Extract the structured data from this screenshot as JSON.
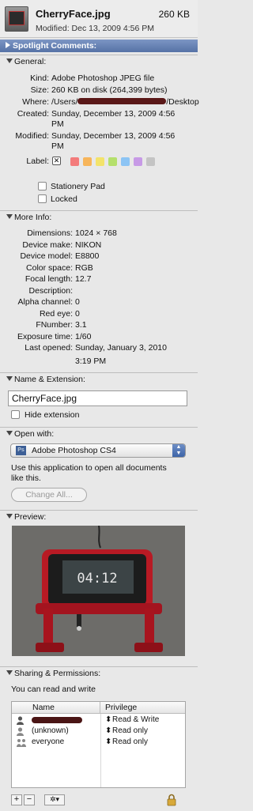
{
  "header": {
    "filename": "CherryFace.jpg",
    "size": "260 KB",
    "modified": "Modified: Dec 13, 2009 4:56 PM"
  },
  "spotlight": {
    "label": "Spotlight Comments:"
  },
  "general": {
    "title": "General:",
    "kind_label": "Kind:",
    "kind": "Adobe Photoshop JPEG file",
    "size_label": "Size:",
    "size": "260 KB on disk (264,399 bytes)",
    "where_label": "Where:",
    "where_prefix": "/Users/",
    "where_suffix": "/Desktop",
    "created_label": "Created:",
    "created_1": "Sunday, December 13, 2009 4:56",
    "created_2": "PM",
    "modified_label": "Modified:",
    "modified_1": "Sunday, December 13, 2009 4:56",
    "modified_2": "PM",
    "label_label": "Label:",
    "stationery": "Stationery Pad",
    "locked": "Locked"
  },
  "more_info": {
    "title": "More Info:",
    "rows": [
      {
        "label": "Dimensions:",
        "value": "1024 × 768"
      },
      {
        "label": "Device make:",
        "value": "NIKON"
      },
      {
        "label": "Device model:",
        "value": "E8800"
      },
      {
        "label": "Color space:",
        "value": "RGB"
      },
      {
        "label": "Focal length:",
        "value": "12.7"
      },
      {
        "label": "Description:",
        "value": ""
      },
      {
        "label": "Alpha channel:",
        "value": "0"
      },
      {
        "label": "Red eye:",
        "value": "0"
      },
      {
        "label": "FNumber:",
        "value": "3.1"
      },
      {
        "label": "Exposure time:",
        "value": "1/60"
      },
      {
        "label": "Last opened:",
        "value": "Sunday, January 3, 2010"
      }
    ],
    "last_opened_2": "3:19 PM"
  },
  "name_ext": {
    "title": "Name & Extension:",
    "name_value": "CherryFace.jpg",
    "hide_ext": "Hide extension"
  },
  "open_with": {
    "title": "Open with:",
    "app": "Adobe Photoshop CS4",
    "app_icon_text": "Ps",
    "desc_1": "Use this application to open all documents",
    "desc_2": "like this.",
    "change_all": "Change All..."
  },
  "preview": {
    "title": "Preview:",
    "clock": "04:12"
  },
  "sharing": {
    "title": "Sharing & Permissions:",
    "summary": "You can read and write",
    "col_name": "Name",
    "col_priv": "Privilege",
    "rows": [
      {
        "name": "",
        "priv": "Read & Write"
      },
      {
        "name": "(unknown)",
        "priv": "Read only"
      },
      {
        "name": "everyone",
        "priv": "Read only"
      }
    ]
  },
  "toolbar": {
    "add": "+",
    "remove": "−",
    "action": "✲▾"
  },
  "colors": {
    "label_colors": [
      "#f37b7b",
      "#f7b55a",
      "#f3e36b",
      "#b5e06c",
      "#8cc4f4",
      "#c79ae6",
      "#c4c4c4"
    ]
  }
}
